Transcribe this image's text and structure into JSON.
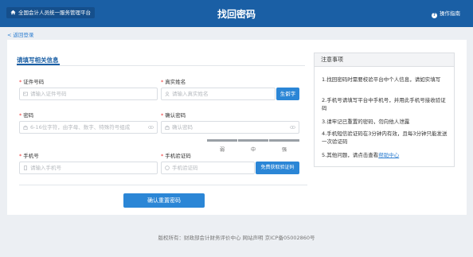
{
  "header": {
    "home_label": "全国会计人员统一服务管理平台",
    "title": "找回密码",
    "guide_label": "操作指南"
  },
  "back_link": "< 返回登录",
  "tab": "请填写相关信息",
  "form": {
    "id_label": "证件号码",
    "id_placeholder": "请输入证件号码",
    "name_label": "真实姓名",
    "name_placeholder": "请输入真实姓名",
    "rare_char_button": "生僻字",
    "password_label": "密码",
    "password_placeholder": "6-16位字符，由字母、数字、特殊符号组成",
    "confirm_label": "确认密码",
    "confirm_placeholder": "确认密码",
    "strength": [
      "弱",
      "中",
      "强"
    ],
    "phone_label": "手机号",
    "phone_placeholder": "请输入手机号",
    "code_label": "手机验证码",
    "code_placeholder": "手机验证码",
    "get_code_button": "免费获取验证码",
    "submit_button": "确认重置密码"
  },
  "notes": {
    "title": "注意事项",
    "items": [
      "1.找回密码时需要校验平台中个人信息，请如实填写",
      "2.手机号请填写平台中手机号，并用此手机号接收验证码",
      "3.请牢记已重置的密码，勿向他人泄露",
      "4.手机短信验证码在3分钟内有效，且每3分钟只能发送一次验证码"
    ],
    "item5_prefix": "5.其他问题，请点击查看",
    "item5_link": "帮助中心"
  },
  "footer": "版权所有：财政部会计财务评价中心 网站声明 京ICP备05002860号"
}
